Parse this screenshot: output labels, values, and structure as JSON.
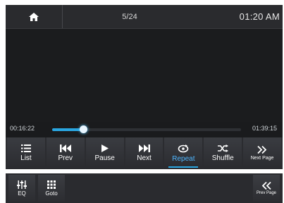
{
  "top_bar": {
    "home_icon": "home-icon",
    "track_position": "5/24",
    "clock": "01:20 AM"
  },
  "playback": {
    "elapsed": "00:16:22",
    "total": "01:39:15",
    "progress_fraction": 0.165
  },
  "controls": [
    {
      "label": "List",
      "icon": "list-icon"
    },
    {
      "label": "Prev",
      "icon": "skip-previous-icon"
    },
    {
      "label": "Pause",
      "icon": "play-icon"
    },
    {
      "label": "Next",
      "icon": "skip-next-icon"
    },
    {
      "label": "Repeat",
      "icon": "repeat-icon",
      "active": true
    },
    {
      "label": "Shuffle",
      "icon": "shuffle-icon"
    },
    {
      "label": "Next Page",
      "icon": "chevron-double-right-icon"
    }
  ],
  "panel": [
    {
      "label": "EQ",
      "icon": "equalizer-icon"
    },
    {
      "label": "Goto",
      "icon": "grid-icon"
    },
    {
      "label": "Prev Page",
      "icon": "chevron-double-left-icon"
    }
  ],
  "colors": {
    "accent": "#2aa6e0",
    "active_label": "#4fb6ff"
  }
}
